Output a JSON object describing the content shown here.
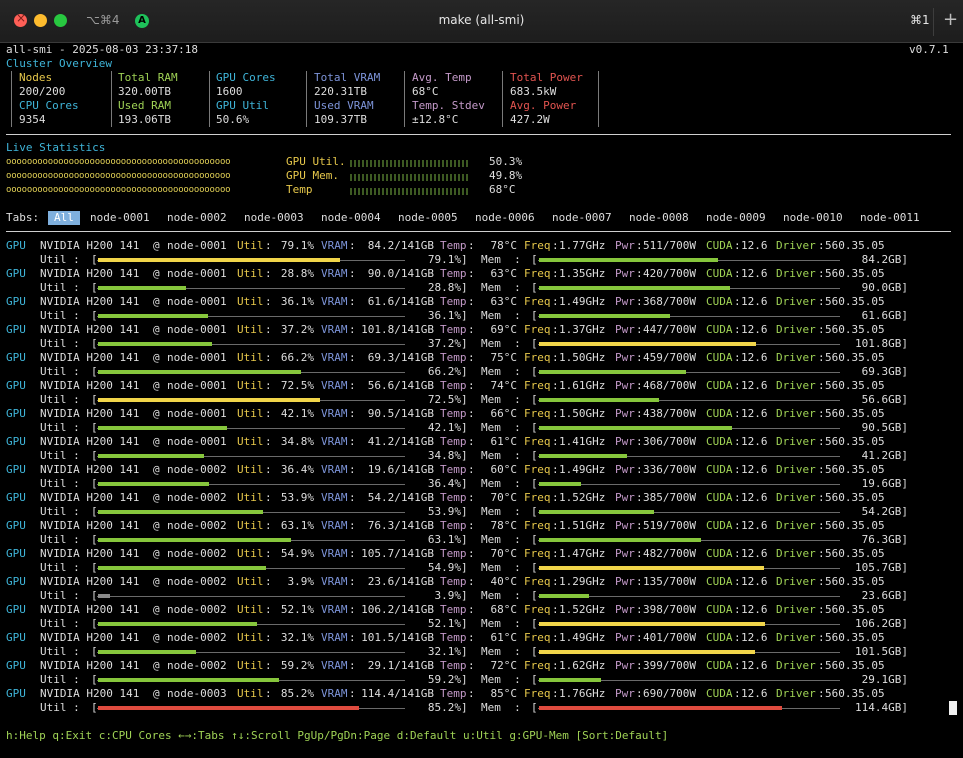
{
  "window": {
    "title": "make (all-smi)",
    "shortcut_left": "⌥⌘4",
    "shortcut_right": "⌘1",
    "app_badge": "A",
    "new_tab": "+"
  },
  "header": {
    "app_line": "all-smi - 2025-08-03 23:37:18",
    "version": "v0.7.1"
  },
  "cluster": {
    "section_title": "Cluster Overview",
    "nodes_label": "Nodes",
    "nodes_value": "200/200",
    "cpu_cores_label": "CPU Cores",
    "cpu_cores_value": "9354",
    "total_ram_label": "Total RAM",
    "total_ram_value": "320.00TB",
    "used_ram_label": "Used RAM",
    "used_ram_value": "193.06TB",
    "gpu_cores_label": "GPU Cores",
    "gpu_cores_value": "1600",
    "gpu_util_label": "GPU Util",
    "gpu_util_value": "50.6%",
    "total_vram_label": "Total VRAM",
    "total_vram_value": "220.31TB",
    "used_vram_label": "Used VRAM",
    "used_vram_value": "109.37TB",
    "avg_temp_label": "Avg. Temp",
    "avg_temp_value": "68°C",
    "temp_stdev_label": "Temp. Stdev",
    "temp_stdev_value": "±12.8°C",
    "total_power_label": "Total Power",
    "total_power_value": "683.5kW",
    "avg_power_label": "Avg. Power",
    "avg_power_value": "427.2W"
  },
  "live": {
    "section_title": "Live Statistics",
    "dots": "ooooooooooooooooooooooooooooooooooooooooooo",
    "rows": [
      {
        "label": "GPU Util.",
        "value": "50.3%"
      },
      {
        "label": "GPU Mem.",
        "value": "49.8%"
      },
      {
        "label": "Temp",
        "value": "68°C"
      }
    ]
  },
  "tabs": {
    "prefix": "Tabs:",
    "items": [
      "All",
      "node-0001",
      "node-0002",
      "node-0003",
      "node-0004",
      "node-0005",
      "node-0006",
      "node-0007",
      "node-0008",
      "node-0009",
      "node-0010",
      "node-0011"
    ],
    "active_index": 0
  },
  "gpu_labels": {
    "gpu": "GPU",
    "util": "Util",
    "vram": "VRAM",
    "temp": "Temp",
    "freq": "Freq",
    "pwr": "Pwr",
    "cuda": "CUDA",
    "driver": "Driver",
    "util_row": "Util :",
    "mem_row": "Mem  :"
  },
  "gpus": [
    {
      "model": "NVIDIA H200 141",
      "node": "node-0001",
      "util": "79.1%",
      "vram": "84.2/141GB",
      "temp": "78°C",
      "freq": "1.77GHz",
      "pwr": "511/700W",
      "cuda": "12.6",
      "driver": "560.35.05",
      "util_frac": 0.791,
      "mem_frac": 0.597,
      "mem_text": "84.2GB]",
      "util_color": "yellow",
      "mem_color": "green"
    },
    {
      "model": "NVIDIA H200 141",
      "node": "node-0001",
      "util": "28.8%",
      "vram": "90.0/141GB",
      "temp": "63°C",
      "freq": "1.35GHz",
      "pwr": "420/700W",
      "cuda": "12.6",
      "driver": "560.35.05",
      "util_frac": 0.288,
      "mem_frac": 0.638,
      "mem_text": "90.0GB]",
      "util_color": "green",
      "mem_color": "green"
    },
    {
      "model": "NVIDIA H200 141",
      "node": "node-0001",
      "util": "36.1%",
      "vram": "61.6/141GB",
      "temp": "63°C",
      "freq": "1.49GHz",
      "pwr": "368/700W",
      "cuda": "12.6",
      "driver": "560.35.05",
      "util_frac": 0.361,
      "mem_frac": 0.437,
      "mem_text": "61.6GB]",
      "util_color": "green",
      "mem_color": "green"
    },
    {
      "model": "NVIDIA H200 141",
      "node": "node-0001",
      "util": "37.2%",
      "vram": "101.8/141GB",
      "temp": "69°C",
      "freq": "1.37GHz",
      "pwr": "447/700W",
      "cuda": "12.6",
      "driver": "560.35.05",
      "util_frac": 0.372,
      "mem_frac": 0.722,
      "mem_text": "101.8GB]",
      "util_color": "green",
      "mem_color": "yellow"
    },
    {
      "model": "NVIDIA H200 141",
      "node": "node-0001",
      "util": "66.2%",
      "vram": "69.3/141GB",
      "temp": "75°C",
      "freq": "1.50GHz",
      "pwr": "459/700W",
      "cuda": "12.6",
      "driver": "560.35.05",
      "util_frac": 0.662,
      "mem_frac": 0.491,
      "mem_text": "69.3GB]",
      "util_color": "green",
      "mem_color": "green"
    },
    {
      "model": "NVIDIA H200 141",
      "node": "node-0001",
      "util": "72.5%",
      "vram": "56.6/141GB",
      "temp": "74°C",
      "freq": "1.61GHz",
      "pwr": "468/700W",
      "cuda": "12.6",
      "driver": "560.35.05",
      "util_frac": 0.725,
      "mem_frac": 0.401,
      "mem_text": "56.6GB]",
      "util_color": "yellow",
      "mem_color": "green"
    },
    {
      "model": "NVIDIA H200 141",
      "node": "node-0001",
      "util": "42.1%",
      "vram": "90.5/141GB",
      "temp": "66°C",
      "freq": "1.50GHz",
      "pwr": "438/700W",
      "cuda": "12.6",
      "driver": "560.35.05",
      "util_frac": 0.421,
      "mem_frac": 0.642,
      "mem_text": "90.5GB]",
      "util_color": "green",
      "mem_color": "green"
    },
    {
      "model": "NVIDIA H200 141",
      "node": "node-0001",
      "util": "34.8%",
      "vram": "41.2/141GB",
      "temp": "61°C",
      "freq": "1.41GHz",
      "pwr": "306/700W",
      "cuda": "12.6",
      "driver": "560.35.05",
      "util_frac": 0.348,
      "mem_frac": 0.292,
      "mem_text": "41.2GB]",
      "util_color": "green",
      "mem_color": "green"
    },
    {
      "model": "NVIDIA H200 141",
      "node": "node-0002",
      "util": "36.4%",
      "vram": "19.6/141GB",
      "temp": "60°C",
      "freq": "1.49GHz",
      "pwr": "336/700W",
      "cuda": "12.6",
      "driver": "560.35.05",
      "util_frac": 0.364,
      "mem_frac": 0.139,
      "mem_text": "19.6GB]",
      "util_color": "green",
      "mem_color": "green"
    },
    {
      "model": "NVIDIA H200 141",
      "node": "node-0002",
      "util": "53.9%",
      "vram": "54.2/141GB",
      "temp": "70°C",
      "freq": "1.52GHz",
      "pwr": "385/700W",
      "cuda": "12.6",
      "driver": "560.35.05",
      "util_frac": 0.539,
      "mem_frac": 0.384,
      "mem_text": "54.2GB]",
      "util_color": "green",
      "mem_color": "green"
    },
    {
      "model": "NVIDIA H200 141",
      "node": "node-0002",
      "util": "63.1%",
      "vram": "76.3/141GB",
      "temp": "78°C",
      "freq": "1.51GHz",
      "pwr": "519/700W",
      "cuda": "12.6",
      "driver": "560.35.05",
      "util_frac": 0.631,
      "mem_frac": 0.541,
      "mem_text": "76.3GB]",
      "util_color": "green",
      "mem_color": "green"
    },
    {
      "model": "NVIDIA H200 141",
      "node": "node-0002",
      "util": "54.9%",
      "vram": "105.7/141GB",
      "temp": "70°C",
      "freq": "1.47GHz",
      "pwr": "482/700W",
      "cuda": "12.6",
      "driver": "560.35.05",
      "util_frac": 0.549,
      "mem_frac": 0.75,
      "mem_text": "105.7GB]",
      "util_color": "green",
      "mem_color": "yellow"
    },
    {
      "model": "NVIDIA H200 141",
      "node": "node-0002",
      "util": "3.9%",
      "vram": "23.6/141GB",
      "temp": "40°C",
      "freq": "1.29GHz",
      "pwr": "135/700W",
      "cuda": "12.6",
      "driver": "560.35.05",
      "util_frac": 0.039,
      "mem_frac": 0.167,
      "mem_text": "23.6GB]",
      "util_color": "gray",
      "mem_color": "green"
    },
    {
      "model": "NVIDIA H200 141",
      "node": "node-0002",
      "util": "52.1%",
      "vram": "106.2/141GB",
      "temp": "68°C",
      "freq": "1.52GHz",
      "pwr": "398/700W",
      "cuda": "12.6",
      "driver": "560.35.05",
      "util_frac": 0.521,
      "mem_frac": 0.753,
      "mem_text": "106.2GB]",
      "util_color": "green",
      "mem_color": "yellow"
    },
    {
      "model": "NVIDIA H200 141",
      "node": "node-0002",
      "util": "32.1%",
      "vram": "101.5/141GB",
      "temp": "61°C",
      "freq": "1.49GHz",
      "pwr": "401/700W",
      "cuda": "12.6",
      "driver": "560.35.05",
      "util_frac": 0.321,
      "mem_frac": 0.72,
      "mem_text": "101.5GB]",
      "util_color": "green",
      "mem_color": "yellow"
    },
    {
      "model": "NVIDIA H200 141",
      "node": "node-0002",
      "util": "59.2%",
      "vram": "29.1/141GB",
      "temp": "72°C",
      "freq": "1.62GHz",
      "pwr": "399/700W",
      "cuda": "12.6",
      "driver": "560.35.05",
      "util_frac": 0.592,
      "mem_frac": 0.206,
      "mem_text": "29.1GB]",
      "util_color": "green",
      "mem_color": "green"
    },
    {
      "model": "NVIDIA H200 141",
      "node": "node-0003",
      "util": "85.2%",
      "vram": "114.4/141GB",
      "temp": "85°C",
      "freq": "1.76GHz",
      "pwr": "690/700W",
      "cuda": "12.6",
      "driver": "560.35.05",
      "util_frac": 0.852,
      "mem_frac": 0.811,
      "mem_text": "114.4GB]",
      "util_color": "red",
      "mem_color": "red"
    }
  ],
  "footer": {
    "help": "h:Help q:Exit c:CPU Cores ←→:Tabs ↑↓:Scroll PgUp/PgDn:Page d:Default u:Util g:GPU-Mem [Sort:Default]"
  },
  "colors": {
    "green": "#86c63c",
    "yellow": "#f1d54a",
    "red": "#df4b3f",
    "gray": "#8a8a8a",
    "cyan": "#3fb5d9",
    "accent_tab": "#7fb0de"
  }
}
